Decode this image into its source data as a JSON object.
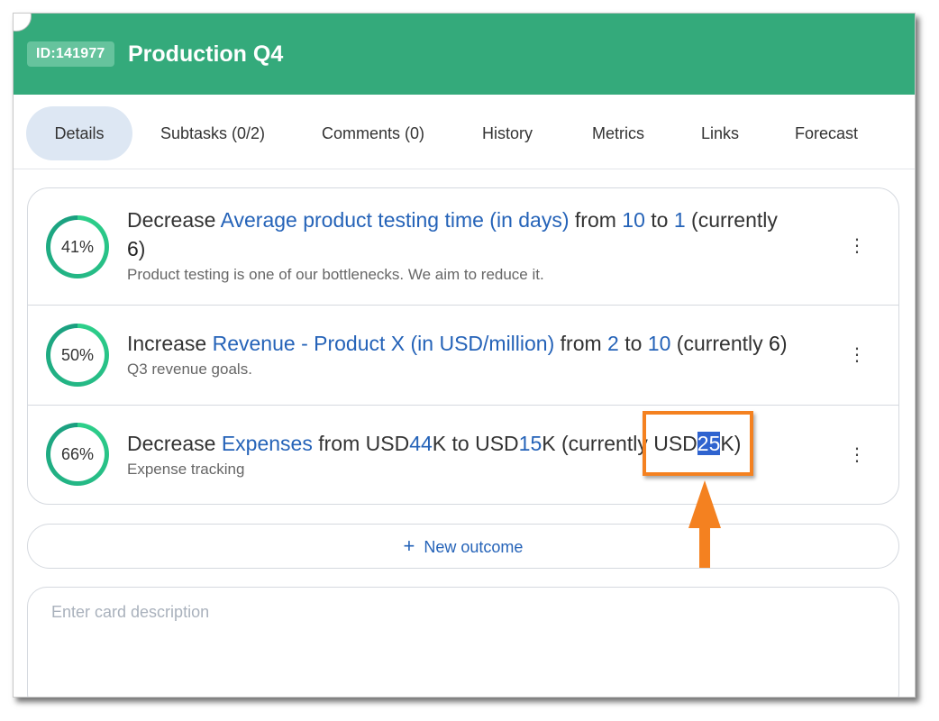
{
  "header": {
    "id_badge": "ID:141977",
    "title": "Production Q4",
    "color": "#34aa7b"
  },
  "tabs": [
    {
      "label": "Details",
      "active": true
    },
    {
      "label": "Subtasks (0/2)",
      "active": false
    },
    {
      "label": "Comments (0)",
      "active": false
    },
    {
      "label": "History",
      "active": false
    },
    {
      "label": "Metrics",
      "active": false
    },
    {
      "label": "Links",
      "active": false
    },
    {
      "label": "Forecast",
      "active": false
    }
  ],
  "outcomes": [
    {
      "progress_label": "41%",
      "progress": 0.41,
      "verb": "Decrease",
      "metric": "Average product testing time (in days)",
      "from_word": "from",
      "from_prefix": "",
      "from_value": "10",
      "from_suffix": "",
      "to_word": "to",
      "to_prefix": "",
      "to_value": "1",
      "to_suffix": "",
      "currently_word": "(currently",
      "current_prefix": "",
      "current_value": "6",
      "current_suffix": ")",
      "description": "Product testing is one of our bottlenecks. We aim to reduce it."
    },
    {
      "progress_label": "50%",
      "progress": 0.5,
      "verb": "Increase",
      "metric": "Revenue - Product X (in USD/million)",
      "from_word": "from",
      "from_prefix": "",
      "from_value": "2",
      "from_suffix": "",
      "to_word": "to",
      "to_prefix": "",
      "to_value": "10",
      "to_suffix": "",
      "currently_word": "(currently",
      "current_prefix": "",
      "current_value": "6",
      "current_suffix": ")",
      "description": "Q3 revenue goals."
    },
    {
      "progress_label": "66%",
      "progress": 0.66,
      "verb": "Decrease",
      "metric": "Expenses",
      "from_word": "from",
      "from_prefix": "USD",
      "from_value": "44",
      "from_suffix": "K",
      "to_word": "to",
      "to_prefix": "USD",
      "to_value": "15",
      "to_suffix": "K",
      "currently_word": "(currently",
      "current_prefix": "USD",
      "current_value": "25",
      "current_suffix": "K)",
      "description": "Expense tracking"
    }
  ],
  "kebab_icon": "⋮",
  "new_outcome": {
    "icon": "plus-icon",
    "label": "New outcome"
  },
  "description_box": {
    "placeholder": "Enter card description"
  },
  "annotation": {
    "color": "#f48120",
    "highlight_color": "#2f63cf"
  }
}
